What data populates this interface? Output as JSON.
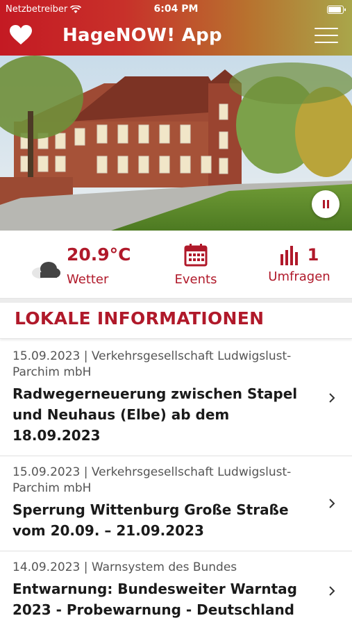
{
  "status_bar": {
    "carrier": "Netzbetreiber",
    "time": "6:04 PM"
  },
  "header": {
    "title": "HageNOW! App",
    "icons": [
      "heart-icon",
      "hamburger-menu-icon"
    ]
  },
  "hero": {
    "description_icon": "pause-icon"
  },
  "quick_bar": {
    "weather": {
      "value": "20.9°C",
      "label": "Wetter",
      "icon": "cloud-icon"
    },
    "events": {
      "label": "Events",
      "icon": "calendar-icon"
    },
    "polls": {
      "count": "1",
      "label": "Umfragen",
      "icon": "bar-chart-icon"
    }
  },
  "section": {
    "title": "LOKALE INFORMATIONEN"
  },
  "news": [
    {
      "meta": "15.09.2023 | Verkehrsgesellschaft Ludwigslust-Parchim mbH",
      "title": "Radwegerneuerung zwischen Stapel und Neuhaus (Elbe) ab dem 18.09.2023"
    },
    {
      "meta": "15.09.2023 | Verkehrsgesellschaft Ludwigslust-Parchim mbH",
      "title": "Sperrung Wittenburg Große Straße vom 20.09. – 21.09.2023"
    },
    {
      "meta": "14.09.2023 | Warnsystem des Bundes",
      "title": "Entwarnung: Bundesweiter Warntag 2023 - Probewarnung - Deutschland"
    }
  ],
  "colors": {
    "accent": "#b0192a",
    "header_start": "#c41a23",
    "header_end": "#a9a64a"
  }
}
